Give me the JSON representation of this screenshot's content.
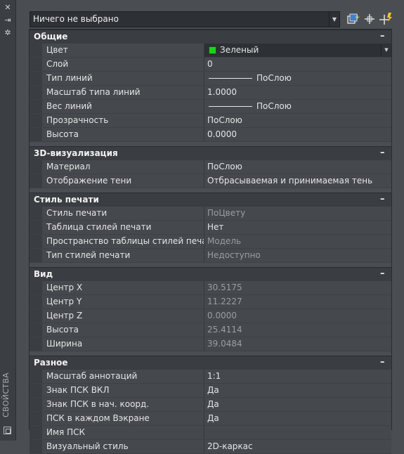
{
  "palette": {
    "title": "СВОЙСТВА"
  },
  "selector": {
    "value": "Ничего не выбрано"
  },
  "toolbar": {
    "icons": [
      "toggle-pickadd-icon",
      "select-objects-icon",
      "quick-select-icon"
    ]
  },
  "sections": {
    "general": {
      "title": "Общие",
      "rows": [
        {
          "label": "Цвет",
          "value": "Зеленый"
        },
        {
          "label": "Слой",
          "value": "0"
        },
        {
          "label": "Тип линий",
          "value": "ПоСлою"
        },
        {
          "label": "Масштаб типа линий",
          "value": "1.0000"
        },
        {
          "label": "Вес линий",
          "value": "ПоСлою"
        },
        {
          "label": "Прозрачность",
          "value": "ПоСлою"
        },
        {
          "label": "Высота",
          "value": "0.0000"
        }
      ]
    },
    "viz3d": {
      "title": "3D-визуализация",
      "rows": [
        {
          "label": "Материал",
          "value": "ПоСлою"
        },
        {
          "label": "Отображение тени",
          "value": "Отбрасываемая и принимаемая тень"
        }
      ]
    },
    "plot": {
      "title": "Стиль печати",
      "rows": [
        {
          "label": "Стиль печати",
          "value": "ПоЦвету"
        },
        {
          "label": "Таблица стилей печати",
          "value": "Нет"
        },
        {
          "label": "Пространство таблицы стилей печати",
          "value": "Модель"
        },
        {
          "label": "Тип стилей печати",
          "value": "Недоступно"
        }
      ]
    },
    "view": {
      "title": "Вид",
      "rows": [
        {
          "label": "Центр X",
          "value": "30.5175"
        },
        {
          "label": "Центр Y",
          "value": "11.2227"
        },
        {
          "label": "Центр Z",
          "value": "0.0000"
        },
        {
          "label": "Высота",
          "value": "25.4114"
        },
        {
          "label": "Ширина",
          "value": "39.0484"
        }
      ]
    },
    "misc": {
      "title": "Разное",
      "rows": [
        {
          "label": "Масштаб аннотаций",
          "value": "1:1"
        },
        {
          "label": "Знак ПСК ВКЛ",
          "value": "Да"
        },
        {
          "label": "Знак ПСК в нач. коорд.",
          "value": "Да"
        },
        {
          "label": "ПСК в каждом Вэкране",
          "value": "Да"
        },
        {
          "label": "Имя ПСК",
          "value": ""
        },
        {
          "label": "Визуальный стиль",
          "value": "2D-каркас"
        }
      ]
    }
  },
  "colors": {
    "swatch_green": "#1fd11f",
    "background": "#4a4d52"
  }
}
